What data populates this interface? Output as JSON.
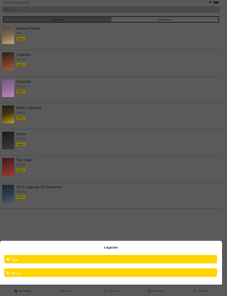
{
  "status": {
    "time": "8:24 PM",
    "date": "Thu Feb 28"
  },
  "search": {
    "placeholder": "Search"
  },
  "segments": [
    {
      "label": "Upcoming",
      "active": false
    },
    {
      "label": "Following",
      "active": true
    }
  ],
  "shows": [
    {
      "title": "Modern Family",
      "network": "ABC",
      "badge": "Status",
      "poster_colors": [
        "#4a4a4a",
        "#7a6a4a",
        "#c9b07a"
      ]
    },
    {
      "title": "Legacies",
      "network": "The CW",
      "badge": "Status",
      "poster_colors": [
        "#2a1a1a",
        "#6a3a2a",
        "#a05a3a"
      ]
    },
    {
      "title": "Supergirl",
      "network": "The CW",
      "badge": "Status",
      "poster_colors": [
        "#6a5a7a",
        "#9a6aa0",
        "#c08ab0"
      ]
    },
    {
      "title": "Black Lightning",
      "network": "The CW",
      "badge": "Status",
      "poster_colors": [
        "#1a1a1a",
        "#4a3a10",
        "#c0a020"
      ]
    },
    {
      "title": "Arrow",
      "network": "The CW",
      "badge": "Status",
      "poster_colors": [
        "#1a1a1a",
        "#2a2a2a",
        "#3a3a3a"
      ]
    },
    {
      "title": "The Flash",
      "network": "The CW",
      "badge": "Status",
      "poster_colors": [
        "#3a1a1a",
        "#6a2a2a",
        "#a03a2a"
      ]
    },
    {
      "title": "DC's Legends Of Tomorrow",
      "network": "The CW",
      "badge": "Status",
      "poster_colors": [
        "#1a2a3a",
        "#2a3a4a",
        "#4a5a6a"
      ]
    }
  ],
  "sheet": {
    "title": "Legacies",
    "actions": [
      {
        "label": "Toggle",
        "icon": "check-circle-icon"
      },
      {
        "label": "Remove",
        "icon": "close-circle-icon"
      }
    ]
  },
  "tabs": [
    {
      "label": "Upcoming",
      "icon": "bar-chart-icon",
      "active": true
    },
    {
      "label": "Shows",
      "icon": "tv-icon",
      "active": false
    },
    {
      "label": "Discover",
      "icon": "compass-icon",
      "active": false
    },
    {
      "label": "Calendar",
      "icon": "calendar-icon",
      "active": false
    },
    {
      "label": "Settings",
      "icon": "gear-icon",
      "active": false
    }
  ],
  "colors": {
    "accent": "#ffd400",
    "overlay": "#5a5a5a",
    "sheet": "#ffffff"
  }
}
